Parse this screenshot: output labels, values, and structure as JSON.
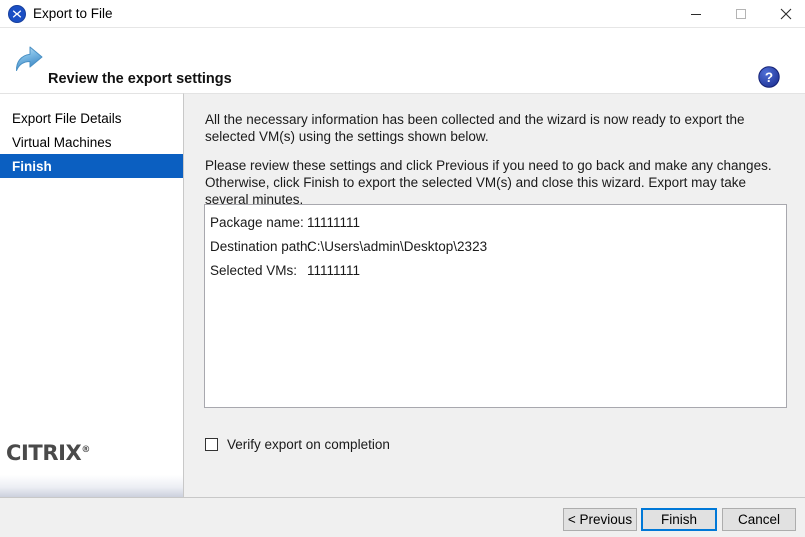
{
  "titlebar": {
    "title": "Export to File",
    "app_icon": "citrix-x-icon",
    "minimize_label": "−",
    "maximize_label": "□",
    "close_label": "✕"
  },
  "header": {
    "title": "Review the export settings",
    "icon": "export-arrow-icon",
    "help_icon": "help-question-icon"
  },
  "sidebar": {
    "items": [
      {
        "label": "Export File Details",
        "selected": false
      },
      {
        "label": "Virtual Machines",
        "selected": false
      },
      {
        "label": "Finish",
        "selected": true
      }
    ],
    "logo": "CITRIX",
    "logo_mark": "®"
  },
  "content": {
    "paragraph1": "All the necessary information has been collected and the wizard is now ready to export the selected VM(s) using the settings shown below.",
    "paragraph2": "Please review these settings and click Previous if you need to go back and make any changes. Otherwise, click Finish to export the selected VM(s) and close this wizard. Export may take several minutes.",
    "summary": [
      {
        "label": "Package name:",
        "value": "11111111"
      },
      {
        "label": "Destination path:",
        "value": "C:\\Users\\admin\\Desktop\\2323"
      },
      {
        "label": "Selected VMs:",
        "value": "11111111"
      }
    ],
    "checkbox": {
      "label": "Verify export on completion",
      "checked": false
    }
  },
  "footer": {
    "previous_label": "< Previous",
    "finish_label": "Finish",
    "cancel_label": "Cancel"
  },
  "colors": {
    "accent": "#0b5fc1",
    "focus_ring": "#0078d7",
    "content_bg": "#f0f0f0",
    "panel_bg": "#ffffff"
  }
}
